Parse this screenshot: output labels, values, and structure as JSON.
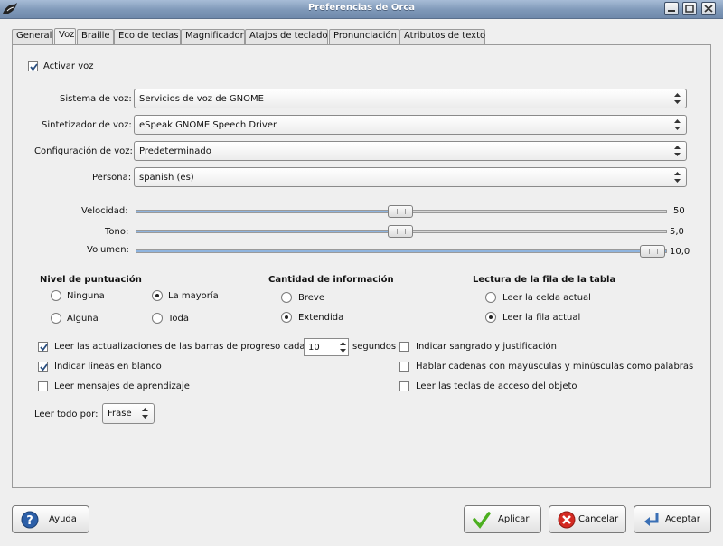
{
  "window": {
    "title": "Preferencias de Orca"
  },
  "tabs": [
    "General",
    "Voz",
    "Braille",
    "Eco de teclas",
    "Magnificador",
    "Atajos de teclado",
    "Pronunciación",
    "Atributos de texto"
  ],
  "active_tab": "Voz",
  "voice": {
    "enable_label": "Activar voz",
    "enable_checked": true,
    "system_label": "Sistema de voz:",
    "system_value": "Servicios de voz de GNOME",
    "synth_label": "Sintetizador de voz:",
    "synth_value": "eSpeak GNOME Speech Driver",
    "config_label": "Configuración de voz:",
    "config_value": "Predeterminado",
    "person_label": "Persona:",
    "person_value": "spanish (es)"
  },
  "sliders": {
    "rate_label": "Velocidad:",
    "rate_value": "50",
    "rate_fraction": 0.5,
    "pitch_label": "Tono:",
    "pitch_value": "5,0",
    "pitch_fraction": 0.5,
    "volume_label": "Volumen:",
    "volume_value": "10,0",
    "volume_fraction": 1.0
  },
  "punctuation": {
    "header": "Nivel de puntuación",
    "options": [
      "Ninguna",
      "La mayoría",
      "Alguna",
      "Toda"
    ],
    "selected": "La mayoría"
  },
  "verbosity": {
    "header": "Cantidad de información",
    "options": [
      "Breve",
      "Extendida"
    ],
    "selected": "Extendida"
  },
  "table_rows": {
    "header": "Lectura de la fila de la tabla",
    "options": [
      "Leer la celda actual",
      "Leer la fila actual"
    ],
    "selected": "Leer la fila actual"
  },
  "checks": {
    "progress_label": "Leer las actualizaciones de las barras de progreso cada",
    "progress_checked": true,
    "progress_value": "10",
    "progress_unit": "segundos",
    "blank_label": "Indicar líneas en blanco",
    "blank_checked": true,
    "tutorial_label": "Leer mensajes de aprendizaje",
    "tutorial_checked": false,
    "indent_label": "Indicar sangrado y justificación",
    "indent_checked": false,
    "mixed_label": "Hablar cadenas con mayúsculas y minúsculas como palabras",
    "mixed_checked": false,
    "access_label": "Leer las teclas de acceso del objeto",
    "access_checked": false
  },
  "say_all": {
    "label": "Leer todo por:",
    "value": "Frase"
  },
  "buttons": {
    "help": "Ayuda",
    "apply": "Aplicar",
    "cancel": "Cancelar",
    "ok": "Aceptar"
  },
  "colors": {
    "titlebar": "#7f98b8",
    "slider_fill": "#8fb4de",
    "apply_icon": "#4caf20",
    "cancel_icon": "#d42a22",
    "help_icon": "#2c5fa8"
  }
}
